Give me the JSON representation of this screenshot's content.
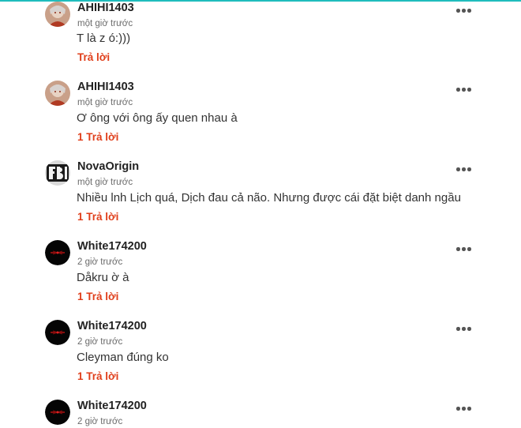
{
  "comments": [
    {
      "avatar": "ahihi-avatar",
      "user": "AHIHI1403",
      "time": "một giờ trước",
      "text": "T là z ó:)))",
      "reply": "Trả lời"
    },
    {
      "avatar": "ahihi-avatar",
      "user": "AHIHI1403",
      "time": "một giờ trước",
      "text": "Ơ ông với ông ấy quen nhau à",
      "reply": "1 Trả lời"
    },
    {
      "avatar": "fbi-avatar",
      "user": "NovaOrigin",
      "time": "một giờ trước",
      "text": "Nhiều lnh Lịch quá, Dịch đau cả não. Nhưng được cái đặt biệt danh ngầu",
      "reply": "1 Trả lời"
    },
    {
      "avatar": "dark-avatar",
      "user": "White174200",
      "time": "2 giờ trước",
      "text": "Dåkru ờ à",
      "reply": "1 Trả lời"
    },
    {
      "avatar": "dark-avatar",
      "user": "White174200",
      "time": "2 giờ trước",
      "text": "Cleyman đúng ko",
      "reply": "1 Trả lời"
    },
    {
      "avatar": "dark-avatar",
      "user": "White174200",
      "time": "2 giờ trước",
      "text": "",
      "reply": ""
    }
  ],
  "colors": {
    "accent_top": "#1fbdbd",
    "reply": "#e03e1a",
    "username": "#222222",
    "timestamp": "#6b6b6b"
  }
}
